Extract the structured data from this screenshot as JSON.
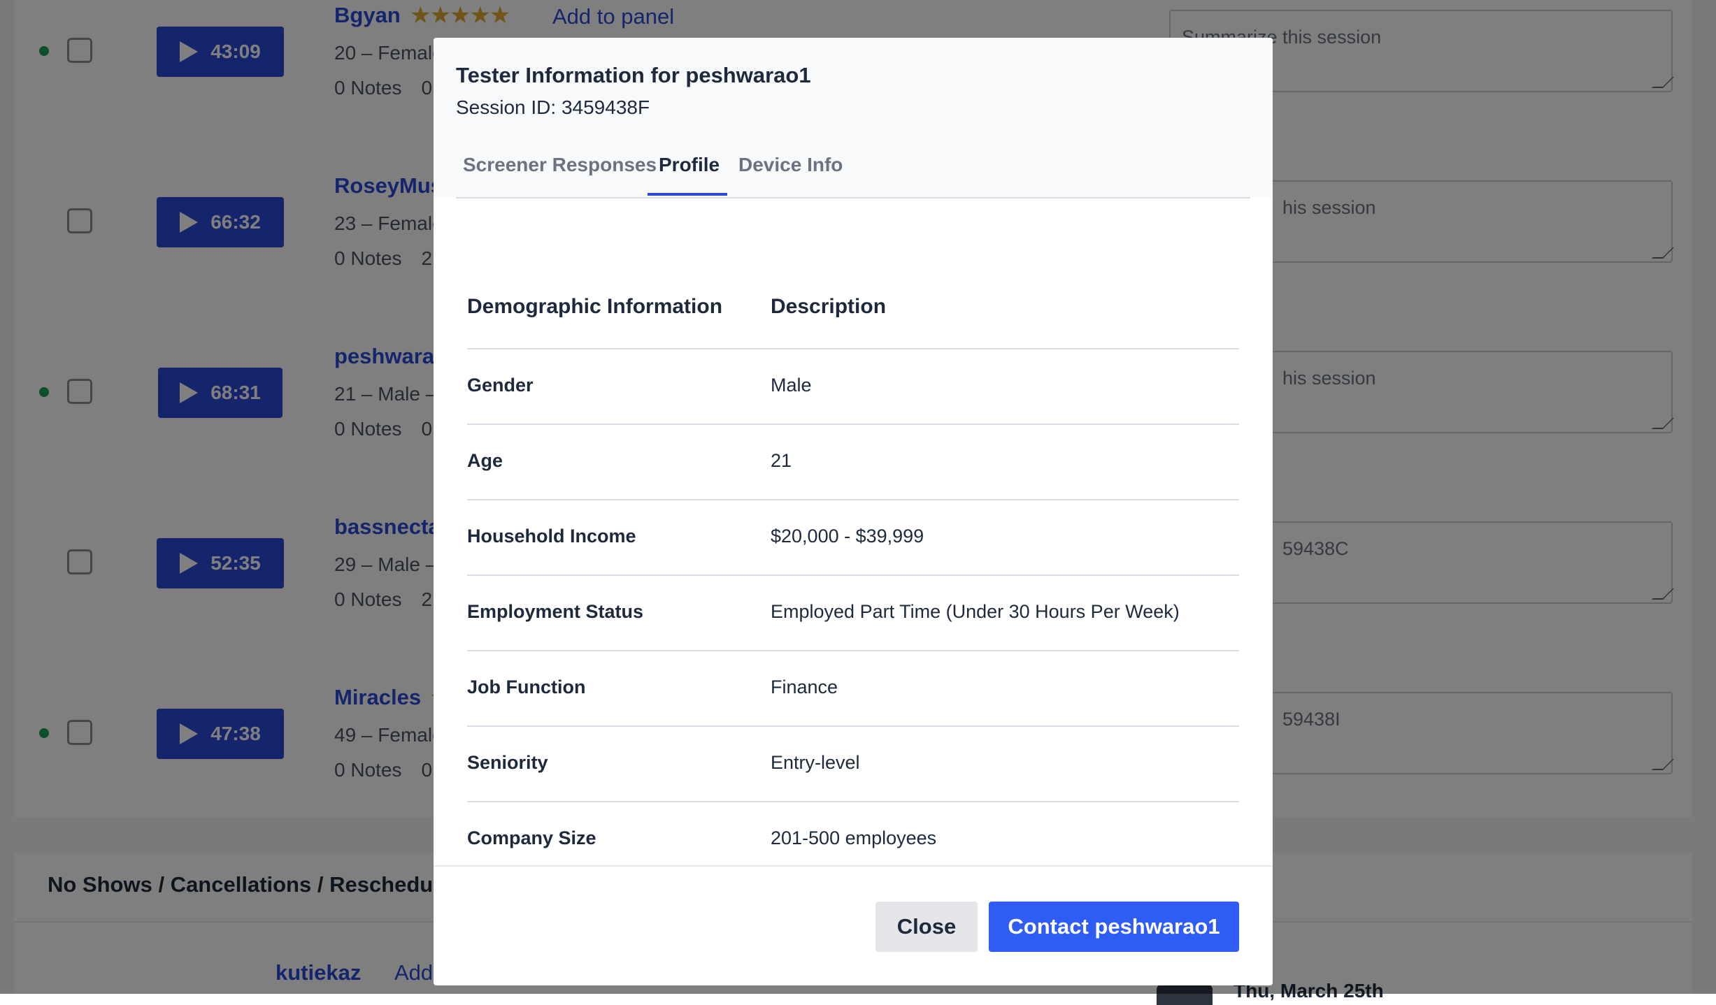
{
  "background": {
    "rows": [
      {
        "online": true,
        "duration": "43:09",
        "username": "Bgyan",
        "stars": "★★★★★",
        "add_to_panel": "Add to panel",
        "meta": "20 – Female",
        "notes": "0 Notes",
        "extra": "0 C",
        "summary_placeholder": "Summarize this session"
      },
      {
        "online": false,
        "duration": "66:32",
        "username": "RoseyMusic",
        "stars": "",
        "add_to_panel": "",
        "meta": "23 – Female",
        "notes": "0 Notes",
        "extra": "2 C",
        "summary_placeholder": "his session"
      },
      {
        "online": true,
        "duration": "68:31",
        "username": "peshwarao1",
        "stars": "",
        "add_to_panel": "",
        "meta": "21 – Male – $",
        "notes": "0 Notes",
        "extra": "0 C",
        "summary_placeholder": "his session"
      },
      {
        "online": false,
        "duration": "52:35",
        "username": "bassnectar",
        "stars": "",
        "add_to_panel": "",
        "meta": "29 – Male – $",
        "notes": "0 Notes",
        "extra": "2 C",
        "summary_placeholder": "59438C"
      },
      {
        "online": true,
        "duration": "47:38",
        "username": "Miracles",
        "stars": "★",
        "add_to_panel": "",
        "meta": "49 – Female",
        "notes": "0 Notes",
        "extra": "0 C",
        "summary_placeholder": "59438I"
      }
    ],
    "section_title": "No Shows / Cancellations / Reschedule",
    "lower_username": "kutiekaz",
    "lower_add": "Add",
    "lower_date": "Thu, March 25th"
  },
  "modal": {
    "title": "Tester Information for peshwarao1",
    "session_id": "Session ID: 3459438F",
    "tabs": [
      "Screener Responses",
      "Profile",
      "Device Info"
    ],
    "active_tab": "Profile",
    "table": {
      "headers": [
        "Demographic Information",
        "Description"
      ],
      "rows": [
        {
          "label": "Gender",
          "value": "Male"
        },
        {
          "label": "Age",
          "value": "21"
        },
        {
          "label": "Household Income",
          "value": "$20,000 - $39,999"
        },
        {
          "label": "Employment Status",
          "value": "Employed Part Time (Under 30 Hours Per Week)"
        },
        {
          "label": "Job Function",
          "value": "Finance"
        },
        {
          "label": "Seniority",
          "value": "Entry-level"
        },
        {
          "label": "Company Size",
          "value": "201-500 employees"
        }
      ]
    },
    "close_label": "Close",
    "contact_label": "Contact peshwarao1"
  },
  "colors": {
    "accent": "#2a4bd7",
    "primary_button": "#2f5cf5",
    "star": "#e2a833",
    "online_dot": "#1f9d55"
  }
}
